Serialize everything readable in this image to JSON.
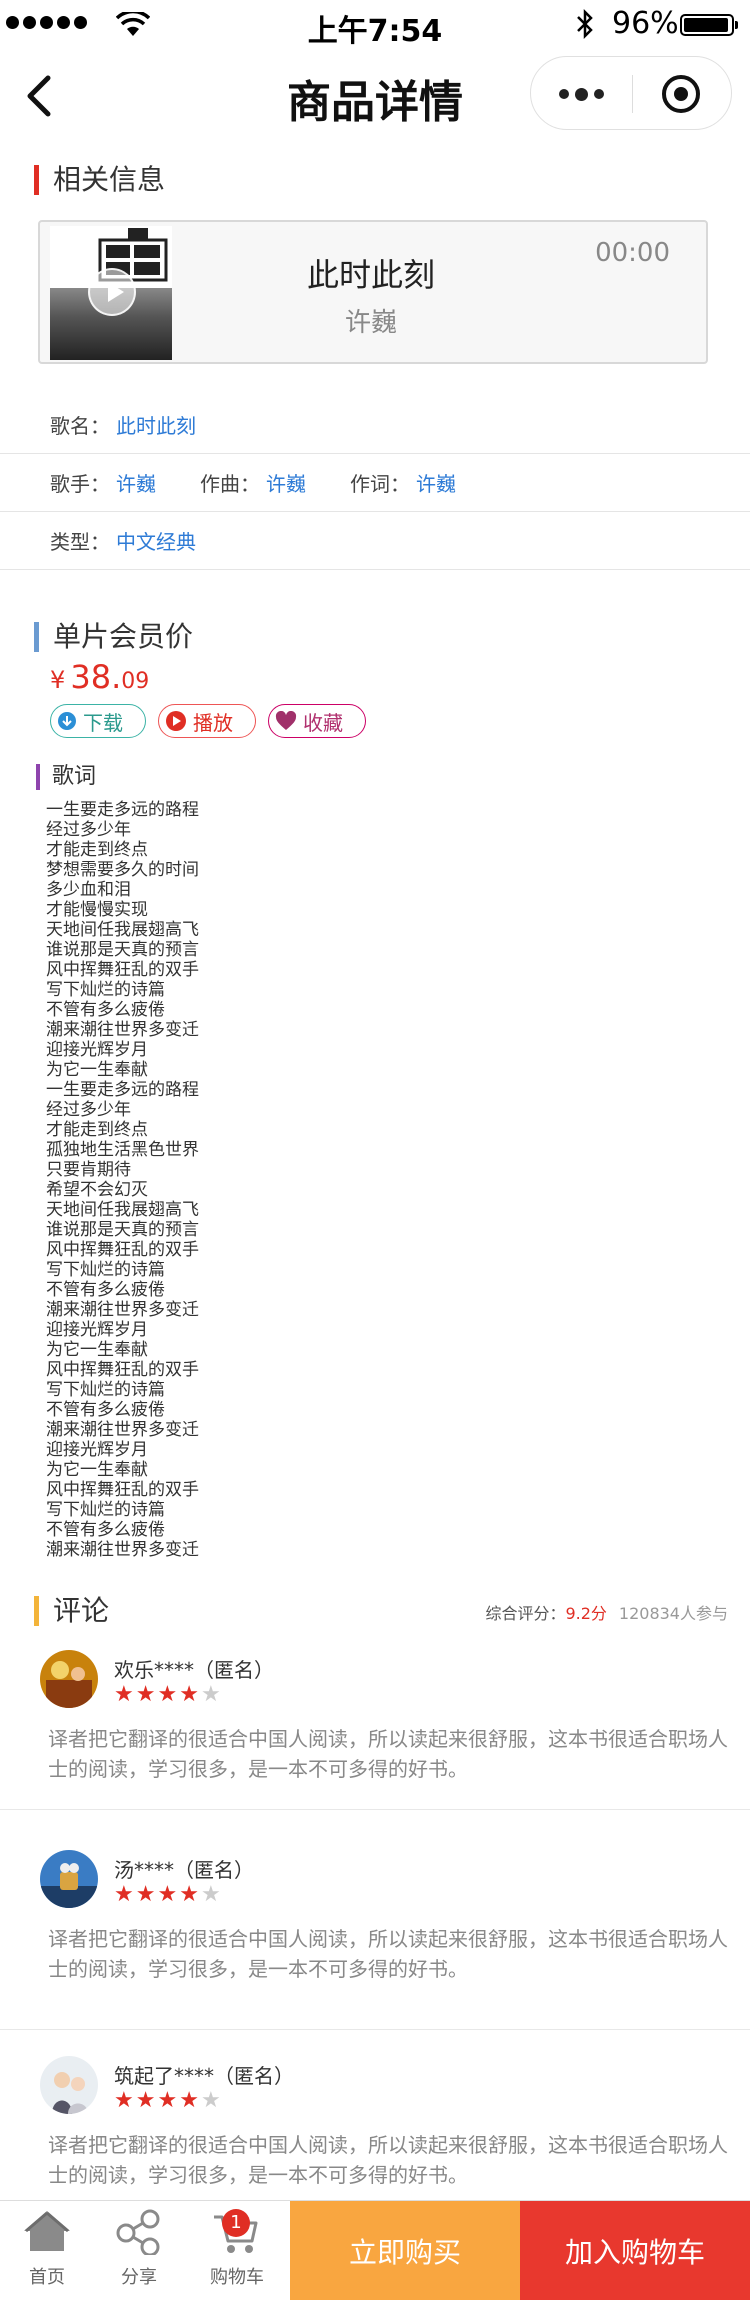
{
  "status_bar": {
    "time": "上午7:54",
    "battery_percent": "96%",
    "battery_level": 0.96
  },
  "nav": {
    "title": "商品详情"
  },
  "related": {
    "title": "相关信息",
    "player": {
      "song": "此时此刻",
      "artist": "许巍",
      "time": "00:00"
    },
    "rows": {
      "song_label": "歌名：",
      "song_value": "此时此刻",
      "singer_label": "歌手：",
      "singer_value": "许巍",
      "composer_label": "作曲：",
      "composer_value": "许巍",
      "lyricist_label": "作词：",
      "lyricist_value": "许巍",
      "type_label": "类型：",
      "type_value": "中文经典"
    }
  },
  "price": {
    "title": "单片会员价",
    "currency": "¥",
    "integer": "38.",
    "decimal": "09"
  },
  "actions": {
    "download": "下载",
    "play": "播放",
    "favorite": "收藏"
  },
  "lyrics": {
    "title": "歌词",
    "lines": [
      "一生要走多远的路程",
      "经过多少年",
      "才能走到终点",
      "梦想需要多久的时间",
      "多少血和泪",
      "才能慢慢实现",
      "天地间任我展翅高飞",
      "谁说那是天真的预言",
      "风中挥舞狂乱的双手",
      "写下灿烂的诗篇",
      "不管有多么疲倦",
      "潮来潮往世界多变迁",
      "迎接光辉岁月",
      "为它一生奉献",
      "一生要走多远的路程",
      "经过多少年",
      "才能走到终点",
      "孤独地生活黑色世界",
      "只要肯期待",
      "希望不会幻灭",
      "天地间任我展翅高飞",
      "谁说那是天真的预言",
      "风中挥舞狂乱的双手",
      "写下灿烂的诗篇",
      "不管有多么疲倦",
      "潮来潮往世界多变迁",
      "迎接光辉岁月",
      "为它一生奉献",
      "风中挥舞狂乱的双手",
      "写下灿烂的诗篇",
      "不管有多么疲倦",
      "潮来潮往世界多变迁",
      "迎接光辉岁月",
      "为它一生奉献",
      "风中挥舞狂乱的双手",
      "写下灿烂的诗篇",
      "不管有多么疲倦",
      "潮来潮往世界多变迁"
    ]
  },
  "reviews": {
    "title": "评论",
    "summary_label": "综合评分：",
    "score": "9.2分",
    "participants": "120834人参与",
    "items": [
      {
        "name": "欢乐****（匿名）",
        "rating": 4,
        "text": "译者把它翻译的很适合中国人阅读，所以读起来很舒服，这本书很适合职场人士的阅读，学习很多，是一本不可多得的好书。"
      },
      {
        "name": "汤****（匿名）",
        "rating": 4,
        "text": "译者把它翻译的很适合中国人阅读，所以读起来很舒服，这本书很适合职场人士的阅读，学习很多，是一本不可多得的好书。"
      },
      {
        "name": "筑起了****（匿名）",
        "rating": 4,
        "text": "译者把它翻译的很适合中国人阅读，所以读起来很舒服，这本书很适合职场人士的阅读，学习很多，是一本不可多得的好书。"
      }
    ]
  },
  "tab_bar": {
    "home": "首页",
    "share": "分享",
    "cart": "购物车",
    "cart_badge": "1",
    "buy_now": "立即购买",
    "add_to_cart": "加入购物车"
  },
  "colors": {
    "accent_red": "#e02e24",
    "link_blue": "#2e7bd6",
    "buy_orange": "#f9a640",
    "cart_red": "#e8382e"
  }
}
